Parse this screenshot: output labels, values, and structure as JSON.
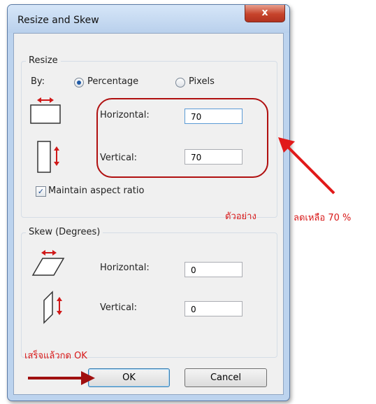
{
  "window": {
    "title": "Resize and Skew",
    "close_glyph": "x"
  },
  "resize": {
    "legend": "Resize",
    "by_label": "By:",
    "options": [
      {
        "label": "Percentage",
        "selected": true
      },
      {
        "label": "Pixels",
        "selected": false
      }
    ],
    "horizontal_label": "Horizontal:",
    "horizontal_value": "70",
    "vertical_label": "Vertical:",
    "vertical_value": "70",
    "maintain_label": "Maintain aspect ratio",
    "maintain_checked": true,
    "icons": [
      "resize-horizontal-icon",
      "resize-vertical-icon"
    ]
  },
  "skew": {
    "legend": "Skew (Degrees)",
    "horizontal_label": "Horizontal:",
    "horizontal_value": "0",
    "vertical_label": "Vertical:",
    "vertical_value": "0",
    "icons": [
      "skew-horizontal-icon",
      "skew-vertical-icon"
    ]
  },
  "buttons": {
    "ok": "OK",
    "cancel": "Cancel"
  },
  "annotations": {
    "example": "ตัวอย่าง",
    "reduce": "ลดเหลือ 70 %",
    "done": "เสร็จแล้วกด OK",
    "color": "#d81818"
  },
  "colors": {
    "accent": "#1f5aa6",
    "annotation": "#d81818",
    "close": "#c6432b"
  }
}
